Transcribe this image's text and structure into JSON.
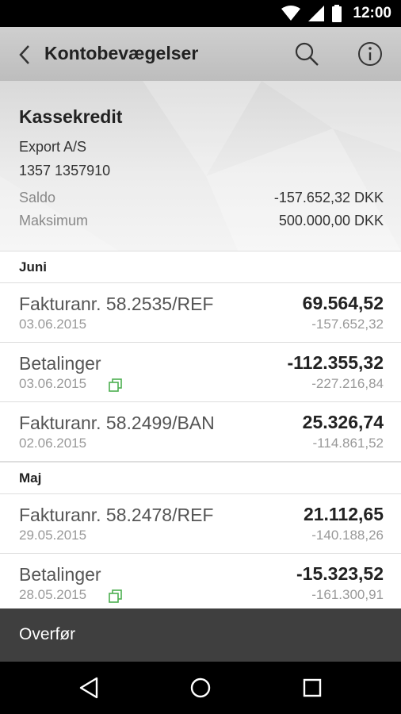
{
  "status_bar": {
    "time": "12:00"
  },
  "app_bar": {
    "title": "Kontobevægelser"
  },
  "account": {
    "name": "Kassekredit",
    "company": "Export A/S",
    "number": "1357 1357910",
    "balance_label": "Saldo",
    "balance_value": "-157.652,32 DKK",
    "max_label": "Maksimum",
    "max_value": "500.000,00 DKK"
  },
  "sections": [
    {
      "label": "Juni",
      "transactions": [
        {
          "description": "Fakturanr. 58.2535/REF",
          "date": "03.06.2015",
          "amount": "69.564,52",
          "balance": "-157.652,32",
          "has_copy_icon": false
        },
        {
          "description": "Betalinger",
          "date": "03.06.2015",
          "amount": "-112.355,32",
          "balance": "-227.216,84",
          "has_copy_icon": true
        },
        {
          "description": "Fakturanr. 58.2499/BAN",
          "date": "02.06.2015",
          "amount": "25.326,74",
          "balance": "-114.861,52",
          "has_copy_icon": false
        }
      ]
    },
    {
      "label": "Maj",
      "transactions": [
        {
          "description": "Fakturanr. 58.2478/REF",
          "date": "29.05.2015",
          "amount": "21.112,65",
          "balance": "-140.188,26",
          "has_copy_icon": false
        },
        {
          "description": "Betalinger",
          "date": "28.05.2015",
          "amount": "-15.323,52",
          "balance": "-161.300,91",
          "has_copy_icon": true
        }
      ]
    }
  ],
  "footer": {
    "label": "Overfør"
  },
  "colors": {
    "accent_green": "#4caf50",
    "footer_bg": "#3f3f3f"
  }
}
